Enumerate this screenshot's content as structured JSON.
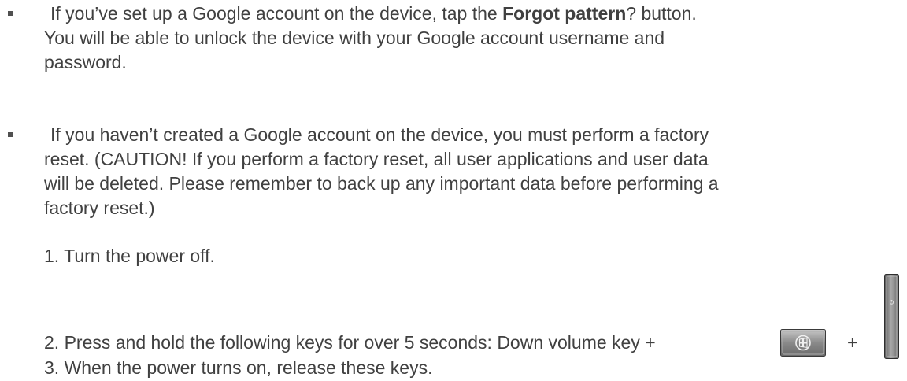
{
  "bullets": [
    {
      "line1_pre": "If you’ve set up a Google account on the device, tap the ",
      "line1_bold": "Forgot pattern",
      "line1_post": "? button.",
      "line2": "You will be able to unlock the device with your Google account username and",
      "line3": "password."
    },
    {
      "line1": "If you haven’t created a Google account on the device, you must perform a factory",
      "line2": "reset. (CAUTION! If you perform a factory reset, all user applications and user data",
      "line3": "will be deleted. Please remember to back up any important data before performing a",
      "line4": "factory reset.)"
    }
  ],
  "steps": {
    "step1": "1. Turn the power off.",
    "step2": "2. Press and hold the following keys for over 5 seconds: Down volume key +",
    "step2_plus": "+",
    "step3": "3. When the power turns on, release these keys."
  },
  "icons": {
    "home_key": "windows-home-key-icon",
    "power_key": "power-key-icon"
  },
  "colors": {
    "text": "#404040",
    "key_face": "#8a8a8a",
    "key_border": "#3a3a3a"
  }
}
